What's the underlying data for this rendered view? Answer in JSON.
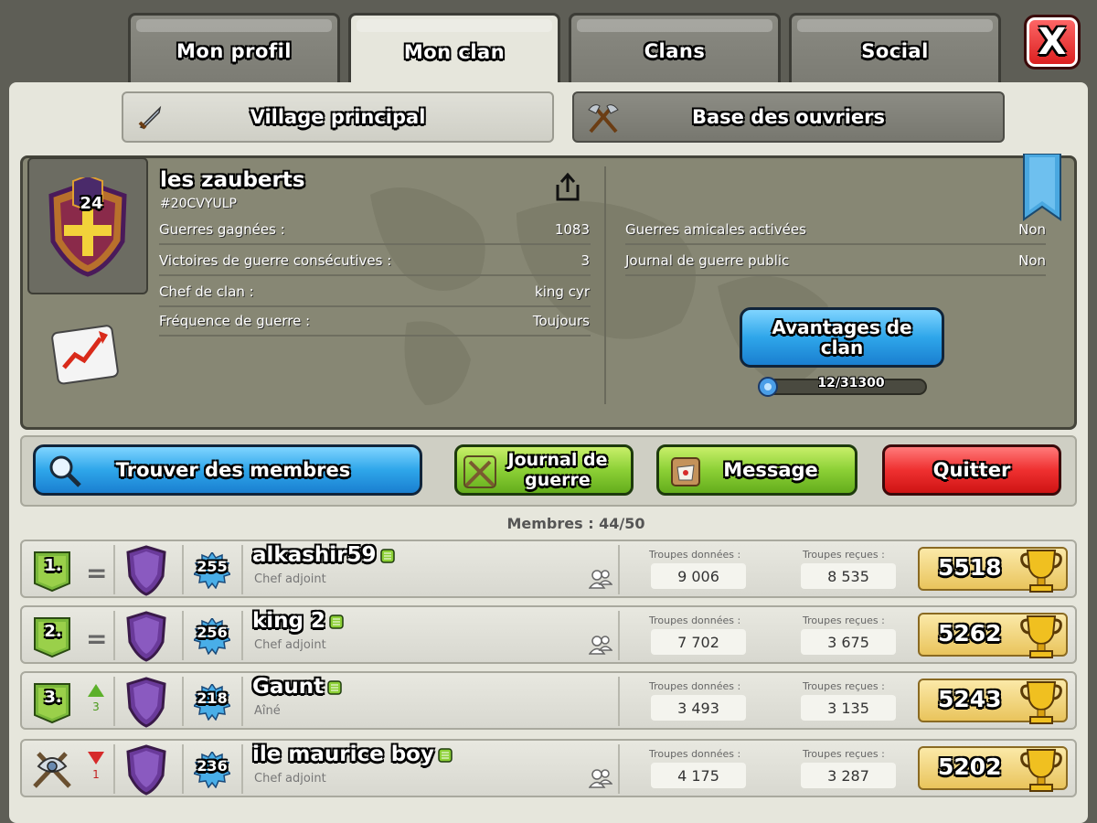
{
  "tabs": [
    {
      "label": "Mon profil"
    },
    {
      "label": "Mon clan"
    },
    {
      "label": "Clans"
    },
    {
      "label": "Social"
    }
  ],
  "close_label": "X",
  "village_buttons": {
    "main": "Village principal",
    "builder": "Base des ouvriers"
  },
  "clan": {
    "name": "les zauberts",
    "tag": "#20CVYULP",
    "level": "24",
    "stats_left": [
      {
        "label": "Guerres gagnées :",
        "value": "1083"
      },
      {
        "label": "Victoires de guerre consécutives :",
        "value": "3"
      },
      {
        "label": "Chef de clan :",
        "value": "king cyr"
      },
      {
        "label": "Fréquence de guerre :",
        "value": "Toujours"
      }
    ],
    "stats_right": [
      {
        "label": "Guerres amicales activées",
        "value": "Non"
      },
      {
        "label": "Journal de guerre public",
        "value": "Non"
      }
    ],
    "perks_button": "Avantages de clan",
    "xp_progress": "12/31300",
    "xp_fraction": 0.0004
  },
  "actions": {
    "find_members": "Trouver des membres",
    "war_log": "Journal de guerre",
    "message": "Message",
    "leave": "Quitter"
  },
  "members_header": "Membres : 44/50",
  "troops_given_label": "Troupes données :",
  "troops_received_label": "Troupes reçues :",
  "members": [
    {
      "rank": "1.",
      "change": "=",
      "change_count": "",
      "level": "255",
      "name": "alkashir59",
      "role": "Chef adjoint",
      "donated": "9 006",
      "received": "8 535",
      "trophies": "5518"
    },
    {
      "rank": "2.",
      "change": "=",
      "change_count": "",
      "level": "256",
      "name": "king 2",
      "role": "Chef adjoint",
      "donated": "7 702",
      "received": "3 675",
      "trophies": "5262"
    },
    {
      "rank": "3.",
      "change": "up",
      "change_count": "3",
      "level": "218",
      "name": "Gaunt",
      "role": "Aîné",
      "donated": "3 493",
      "received": "3 135",
      "trophies": "5243"
    },
    {
      "rank": "",
      "change": "down",
      "change_count": "1",
      "level": "236",
      "name": "ile maurice boy",
      "role": "Chef adjoint",
      "donated": "4 175",
      "received": "3 287",
      "trophies": "5202"
    }
  ]
}
